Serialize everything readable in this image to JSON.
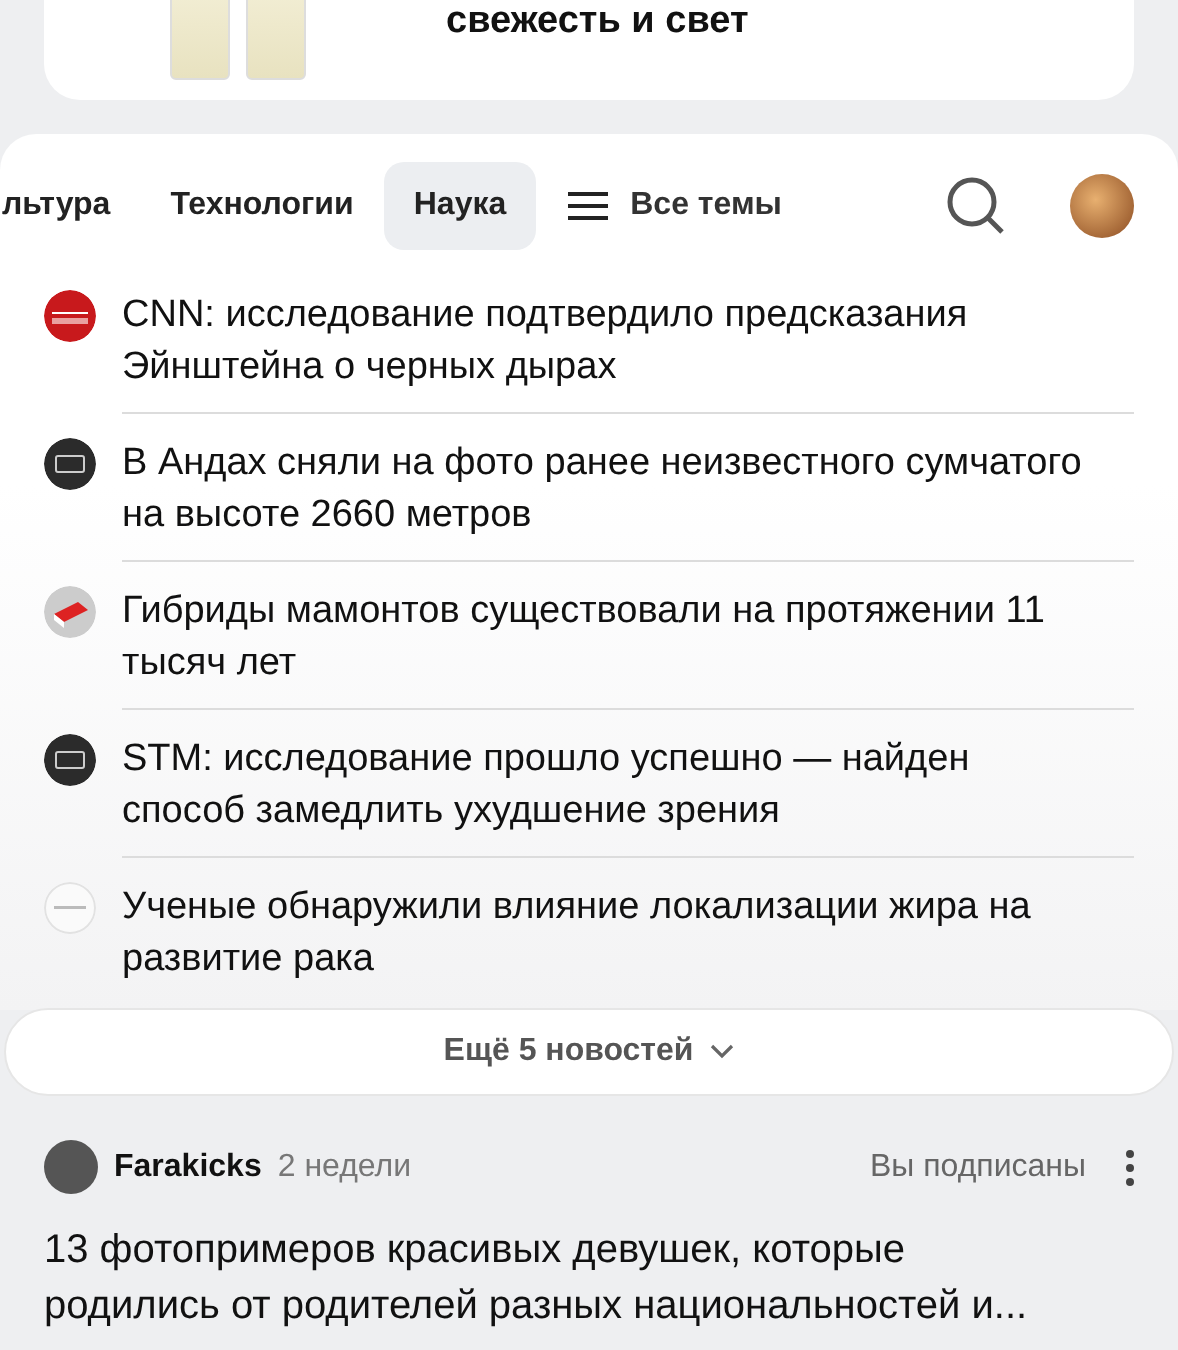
{
  "promo": {
    "title": "свежесть и свет"
  },
  "tabs": [
    {
      "label": "льтура",
      "selected": false
    },
    {
      "label": "Технологии",
      "selected": false
    },
    {
      "label": "Наука",
      "selected": true
    },
    {
      "label": "Все темы",
      "selected": false,
      "kind": "menu"
    }
  ],
  "news": [
    {
      "kind": "red",
      "title": "CNN: исследование подтвердило предсказания Эйнштейна о черных дырах"
    },
    {
      "kind": "dark",
      "title": "В Андах сняли на фото ранее неизвестного сумчатого на высоте 2660 метров"
    },
    {
      "kind": "grey",
      "title": "Гибриды мамонтов существовали на протяжении 11 тысяч лет"
    },
    {
      "kind": "dark",
      "title": "STM: исследование прошло успешно — найден способ замедлить ухудшение зрения"
    },
    {
      "kind": "light",
      "title": "Ученые обнаружили влияние локализации жира на развитие рака"
    }
  ],
  "more_button": "Ещё 5 новостей",
  "post": {
    "author": "Farakicks",
    "time": "2 недели",
    "subscription": "Вы подписаны",
    "title": "13 фотопримеров красивых девушек, которые родились от родителей разных национальностей и..."
  }
}
